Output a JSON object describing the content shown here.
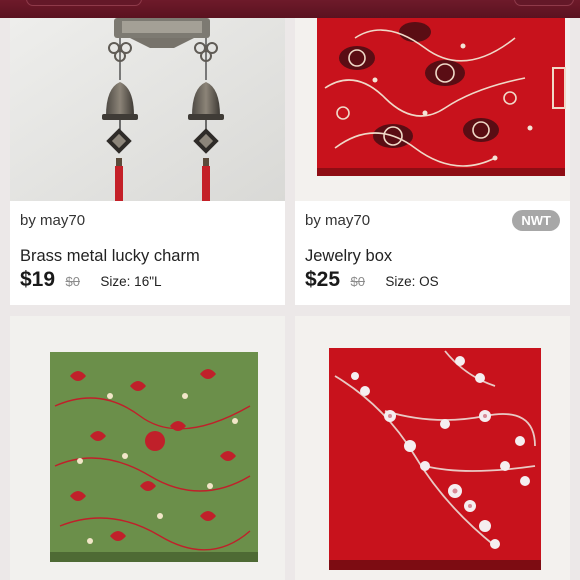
{
  "listings": [
    {
      "seller": "by may70",
      "title": "Brass metal lucky charm",
      "price": "$19",
      "original_price": "$0",
      "size": "Size: 16\"L",
      "badge": ""
    },
    {
      "seller": "by may70",
      "title": "Jewelry box",
      "price": "$25",
      "original_price": "$0",
      "size": "Size: OS",
      "badge": "NWT"
    },
    {
      "seller": "",
      "title": "",
      "price": "",
      "original_price": "",
      "size": "",
      "badge": ""
    },
    {
      "seller": "",
      "title": "",
      "price": "",
      "original_price": "",
      "size": "",
      "badge": ""
    }
  ],
  "colors": {
    "header": "#6e1a2a",
    "badge": "#a7a7a7",
    "silk_red": "#c8121c",
    "silk_green": "#6b8f4a"
  }
}
